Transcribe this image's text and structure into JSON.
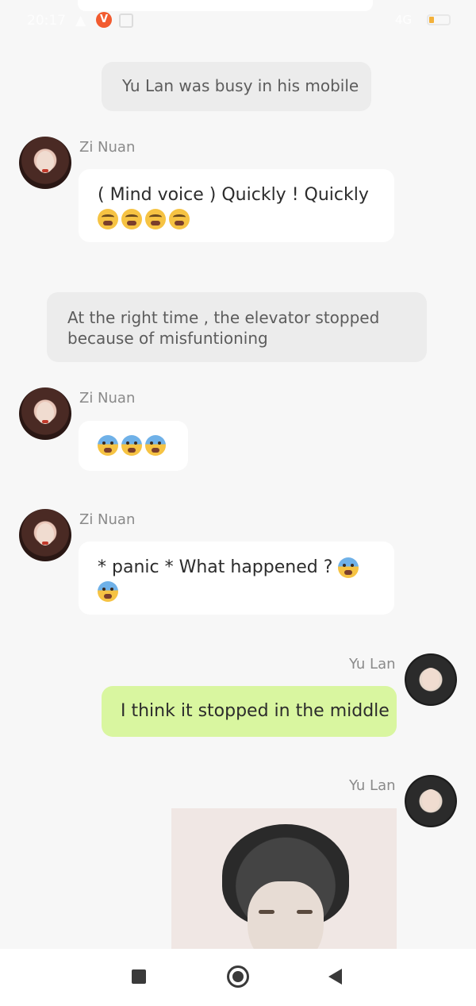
{
  "status_bar": {
    "time": "20:17",
    "network": "4G"
  },
  "messages": [
    {
      "kind": "narration",
      "text": "Yu Lan was busy in his mobile"
    },
    {
      "kind": "left",
      "sender": "Zi Nuan",
      "text": "( Mind voice ) Quickly ! Quickly",
      "emoji": [
        "tired-face",
        "tired-face",
        "tired-face",
        "tired-face"
      ]
    },
    {
      "kind": "narration",
      "text": "At the right time , the elevator stopped because of misfuntioning"
    },
    {
      "kind": "left",
      "sender": "Zi Nuan",
      "text": "",
      "emoji": [
        "anxious-face",
        "anxious-face",
        "anxious-face"
      ]
    },
    {
      "kind": "left",
      "sender": "Zi Nuan",
      "text": "* panic * What happened ?",
      "emoji": [
        "anxious-face",
        "anxious-face"
      ]
    },
    {
      "kind": "right",
      "sender": "Yu Lan",
      "text": "I think it stopped in the middle"
    },
    {
      "kind": "right-image",
      "sender": "Yu Lan"
    }
  ],
  "colors": {
    "background": "#f7f7f7",
    "self_bubble": "#d9f6a0",
    "other_bubble": "#ffffff",
    "narration": "#ececec"
  }
}
